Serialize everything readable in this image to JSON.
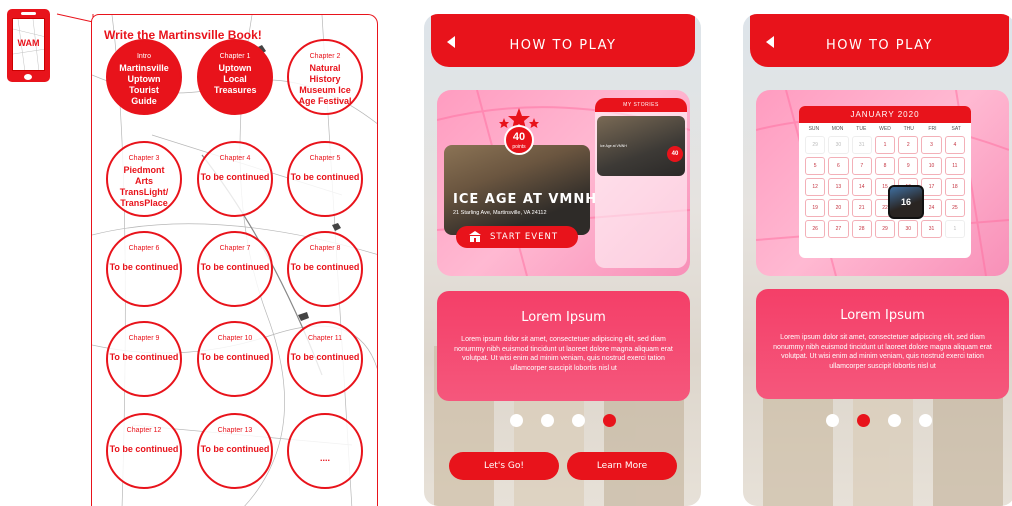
{
  "phone_icon": {
    "label": "WAM"
  },
  "book": {
    "title": "Write the Martinsville Book!",
    "chapters": [
      {
        "label": "Intro",
        "name": "Martinsville Uptown Tourist Guide",
        "filled": true
      },
      {
        "label": "Chapter 1",
        "name": "Uptown Local Treasures",
        "filled": true
      },
      {
        "label": "Chapter 2",
        "name": "Natural History Museum Ice Age Festival",
        "filled": false
      },
      {
        "label": "Chapter 3",
        "name": "Piedmont Arts TransLight/ TransPlace",
        "filled": false
      },
      {
        "label": "Chapter 4",
        "name": "To be continued",
        "filled": false
      },
      {
        "label": "Chapter 5",
        "name": "To be continued",
        "filled": false
      },
      {
        "label": "Chapter 6",
        "name": "To be continued",
        "filled": false
      },
      {
        "label": "Chapter 7",
        "name": "To be continued",
        "filled": false
      },
      {
        "label": "Chapter 8",
        "name": "To be continued",
        "filled": false
      },
      {
        "label": "Chapter 9",
        "name": "To be continued",
        "filled": false
      },
      {
        "label": "Chapter 10",
        "name": "To be continued",
        "filled": false
      },
      {
        "label": "Chapter 11",
        "name": "To be continued",
        "filled": false
      },
      {
        "label": "Chapter 12",
        "name": "To be continued",
        "filled": false
      },
      {
        "label": "Chapter 13",
        "name": "To be continued",
        "filled": false
      },
      {
        "label": "",
        "name": "",
        "more": "....",
        "filled": false
      }
    ]
  },
  "screen1": {
    "header_title": "HOW TO PLAY",
    "event": {
      "title": "ICE AGE AT VMNH",
      "address": "21 Starling Ave, Martinsville, VA 24112",
      "points_value": "40",
      "points_unit": "points",
      "start_label": "START EVENT",
      "stories_label": "MY STORIES",
      "mini_title": "Ice Age at VMNH",
      "mini_badge": "40"
    },
    "info_title": "Lorem Ipsum",
    "info_text": "Lorem ipsum dolor sit amet, consectetuer adipiscing elit, sed diam nonummy nibh euismod tincidunt ut laoreet dolore magna aliquam erat volutpat. Ut wisi enim ad minim veniam, quis nostrud exerci tation ullamcorper suscipit lobortis nisl ut",
    "active_page": 4,
    "lets_go_label": "Let's Go!",
    "learn_more_label": "Learn More"
  },
  "screen2": {
    "header_title": "HOW TO PLAY",
    "calendar": {
      "month": "JANUARY 2020",
      "weekdays": [
        "SUN",
        "MON",
        "TUE",
        "WED",
        "THU",
        "FRI",
        "SAT"
      ],
      "days": [
        "29",
        "30",
        "31",
        "1",
        "2",
        "3",
        "4",
        "5",
        "6",
        "7",
        "8",
        "9",
        "10",
        "11",
        "12",
        "13",
        "14",
        "15",
        "16",
        "17",
        "18",
        "19",
        "20",
        "21",
        "22",
        "23",
        "24",
        "25",
        "26",
        "27",
        "28",
        "29",
        "30",
        "31",
        "1"
      ],
      "highlighted_day": "16"
    },
    "info_title": "Lorem Ipsum",
    "info_text": "Lorem ipsum dolor sit amet, consectetuer adipiscing elit, sed diam nonummy nibh euismod tincidunt ut laoreet dolore magna aliquam erat volutpat. Ut wisi enim ad minim veniam, quis nostrud exerci tation ullamcorper suscipit lobortis nisl ut",
    "active_page": 2
  },
  "colors": {
    "accent": "#e8131b",
    "info_card": "#f43f68",
    "event_card": "#ffb1cc"
  }
}
